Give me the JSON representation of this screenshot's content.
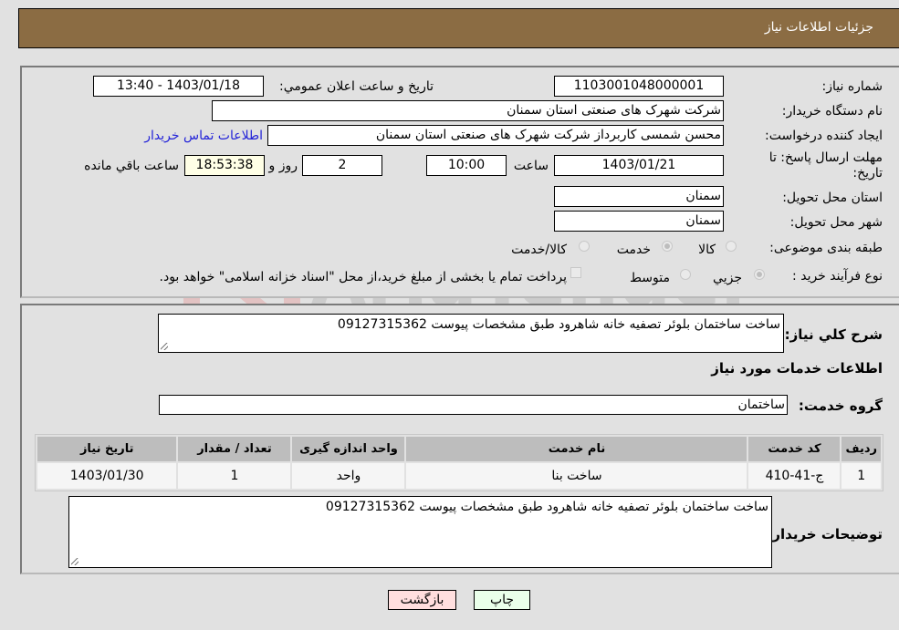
{
  "header": {
    "title": "جزئيات اطلاعات نياز"
  },
  "fields": {
    "need_number": {
      "label": "شماره نياز:",
      "value": "1103001048000001"
    },
    "announce_datetime": {
      "label": "تاريخ و ساعت اعلان عمومي:",
      "value": "1403/01/18 - 13:40"
    },
    "buyer_org": {
      "label": "نام دستگاه خريدار:",
      "value": "شركت شهرک های صنعتی استان سمنان"
    },
    "requester": {
      "label": "ايجاد كننده درخواست:",
      "value": "محسن شمسی کاربرداز شرکت شهرک های صنعتی استان سمنان"
    },
    "buyer_contact_link": "اطلاعات تماس خريدار",
    "deadline": {
      "label_line1": "مهلت ارسال پاسخ: تا",
      "label_line2": "تاريخ:",
      "date": "1403/01/21",
      "time_label": "ساعت",
      "time": "10:00",
      "days": "2",
      "days_label": "روز و",
      "remaining": "18:53:38",
      "remaining_label": "ساعت باقي مانده"
    },
    "delivery_province": {
      "label": "استان محل تحويل:",
      "value": "سمنان"
    },
    "delivery_city": {
      "label": "شهر محل تحويل:",
      "value": "سمنان"
    },
    "category": {
      "label": "طبقه بندی موضوعی:",
      "options": [
        "کالا",
        "خدمت",
        "کالا/خدمت"
      ],
      "selected": "خدمت"
    },
    "purchase_process": {
      "label": "نوع فرآيند خريد :",
      "options": [
        "جزيي",
        "متوسط"
      ],
      "selected": "جزيي",
      "treasury_note": "پرداخت تمام يا بخشی از مبلغ خريد،از محل \"اسناد خزانه اسلامی\" خواهد بود."
    }
  },
  "description": {
    "label": "شرح كلي نياز:",
    "value": "ساخت ساختمان بلوئر تصفیه خانه شاهرود طبق مشخصات پیوست 09127315362"
  },
  "services_section_title": "اطلاعات خدمات مورد نياز",
  "service_group": {
    "label": "گروه خدمت:",
    "value": "ساختمان"
  },
  "services_table": {
    "headers": [
      "رديف",
      "كد خدمت",
      "نام خدمت",
      "واحد اندازه گيری",
      "تعداد / مقدار",
      "تاريخ نياز"
    ],
    "rows": [
      [
        "1",
        "ج-41-410",
        "ساخت بنا",
        "واحد",
        "1",
        "1403/01/30"
      ]
    ]
  },
  "buyer_notes": {
    "label": "توضيحات خريدار:",
    "value": "ساخت ساختمان بلوئر تصفیه خانه شاهرود طبق مشخصات پیوست 09127315362"
  },
  "buttons": {
    "print": "چاپ",
    "back": "بازگشت"
  },
  "colors": {
    "header_bg": "#8b6c43",
    "page_bg": "#e1e1e1",
    "link": "#2323d8",
    "print_bg": "#eaffea",
    "back_bg": "#ffdede"
  },
  "watermark": "AriaTender.neT"
}
